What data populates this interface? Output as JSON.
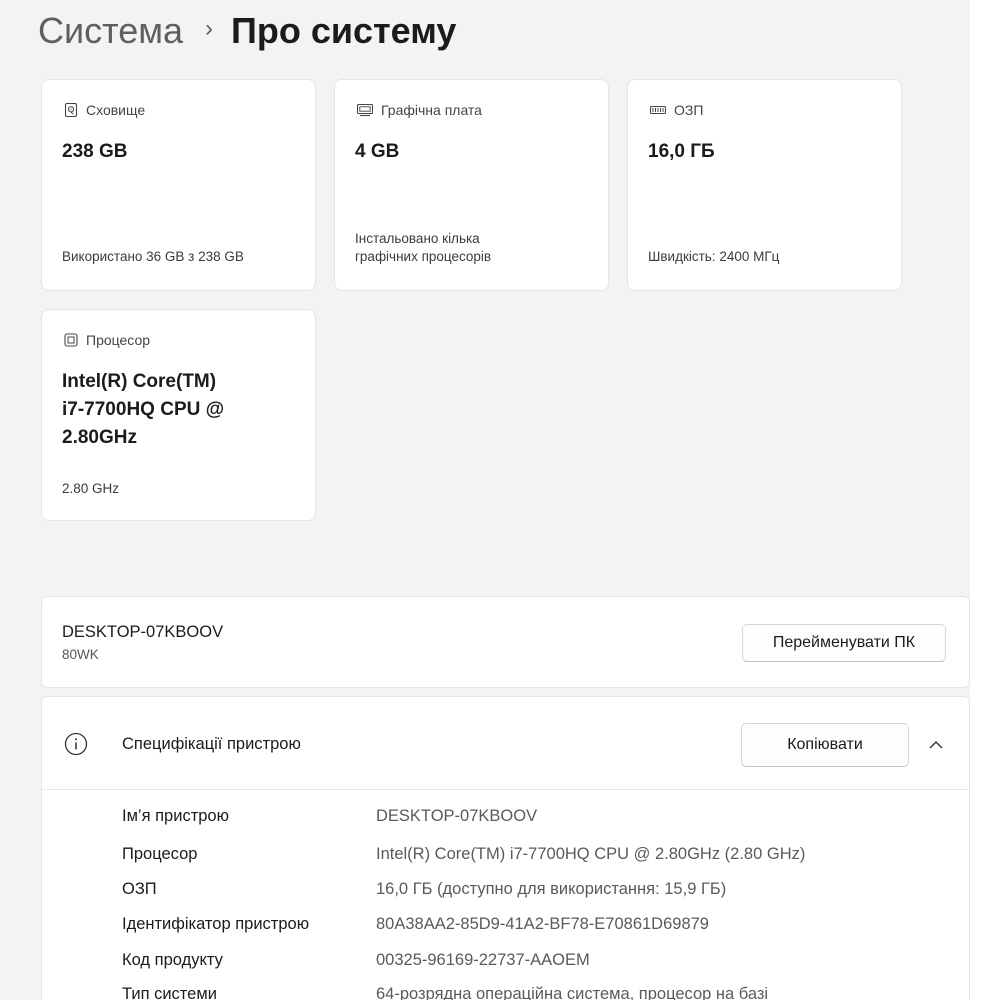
{
  "breadcrumb": {
    "parent": "Система",
    "separator": "›",
    "current": "Про систему"
  },
  "cards": {
    "storage": {
      "icon": "storage-icon",
      "title": "Сховище",
      "value": "238 GB",
      "sub": "Використано 36 GB з 238 GB"
    },
    "gpu": {
      "icon": "graphics-card-icon",
      "title": "Графічна плата",
      "value": "4 GB",
      "sub_line1": "Інстальовано кілька",
      "sub_line2": "графічних процесорів"
    },
    "ram": {
      "icon": "ram-icon",
      "title": "ОЗП",
      "value": "16,0 ГБ",
      "sub": "Швидкість: 2400 МГц"
    },
    "cpu": {
      "icon": "processor-icon",
      "title": "Процесор",
      "value_line1": "Intel(R) Core(TM)",
      "value_line2": "i7-7700HQ CPU @",
      "value_line3": "2.80GHz",
      "sub": "2.80 GHz"
    }
  },
  "device": {
    "name": "DESKTOP-07KBOOV",
    "model": "80WK",
    "rename_label": "Перейменувати ПК"
  },
  "specs": {
    "icon": "info-icon",
    "title": "Специфікації пристрою",
    "copy_label": "Копіювати",
    "expanded": true,
    "rows": [
      {
        "label": "Ім’я пристрою",
        "value": "DESKTOP-07KBOOV"
      },
      {
        "label": "Процесор",
        "value": "Intel(R) Core(TM) i7-7700HQ CPU @ 2.80GHz (2.80 GHz)"
      },
      {
        "label": "ОЗП",
        "value": "16,0 ГБ (доступно для використання: 15,9 ГБ)"
      },
      {
        "label": "Ідентифікатор пристрою",
        "value": "80A38AA2-85D9-41A2-BF78-E70861D69879"
      },
      {
        "label": "Код продукту",
        "value": "00325-96169-22737-AAOEM"
      },
      {
        "label": "Тип системи",
        "value": "64-розрядна операційна система, процесор на базі"
      }
    ]
  }
}
